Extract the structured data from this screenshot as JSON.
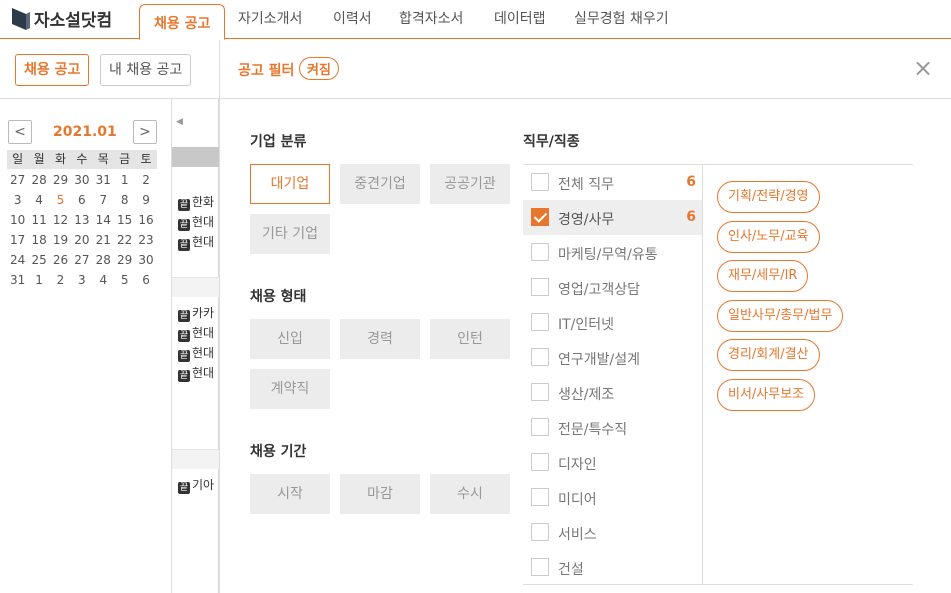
{
  "brand": {
    "name": "자소설닷컴"
  },
  "nav": {
    "tabs": [
      "채용 공고",
      "자기소개서",
      "이력서",
      "합격자소서",
      "데이터랩",
      "실무경험 채우기"
    ]
  },
  "subnav": {
    "buttons": [
      "채용 공고",
      "내 채용 공고"
    ]
  },
  "calendar": {
    "month": "2021.01",
    "prev": "<",
    "next": ">",
    "weekdays": [
      "일",
      "월",
      "화",
      "수",
      "목",
      "금",
      "토"
    ],
    "weeks": [
      [
        "27",
        "28",
        "29",
        "30",
        "31",
        "1",
        "2"
      ],
      [
        "3",
        "4",
        "5",
        "6",
        "7",
        "8",
        "9"
      ],
      [
        "10",
        "11",
        "12",
        "13",
        "14",
        "15",
        "16"
      ],
      [
        "17",
        "18",
        "19",
        "20",
        "21",
        "22",
        "23"
      ],
      [
        "24",
        "25",
        "26",
        "27",
        "28",
        "29",
        "30"
      ],
      [
        "31",
        "1",
        "2",
        "3",
        "4",
        "5",
        "6"
      ]
    ]
  },
  "list": {
    "badge": "끝",
    "groups": [
      [
        "한화",
        "현대",
        "현대"
      ],
      [
        "카카",
        "현대",
        "현대",
        "현대"
      ],
      [
        "기아"
      ]
    ]
  },
  "filter": {
    "title": "공고 필터",
    "badge": "켜짐",
    "close": "×",
    "company": {
      "label": "기업 분류",
      "options": [
        "대기업",
        "중견기업",
        "공공기관",
        "기타 기업"
      ]
    },
    "type": {
      "label": "채용 형태",
      "options": [
        "신입",
        "경력",
        "인턴",
        "계약직"
      ]
    },
    "period": {
      "label": "채용 기간",
      "options": [
        "시작",
        "마감",
        "수시"
      ]
    },
    "jobs": {
      "label": "직무/직종",
      "categories": [
        {
          "name": "전체 직무",
          "count": "6"
        },
        {
          "name": "경영/사무",
          "count": "6"
        },
        {
          "name": "마케팅/무역/유통"
        },
        {
          "name": "영업/고객상담"
        },
        {
          "name": "IT/인터넷"
        },
        {
          "name": "연구개발/설계"
        },
        {
          "name": "생산/제조"
        },
        {
          "name": "전문/특수직"
        },
        {
          "name": "디자인"
        },
        {
          "name": "미디어"
        },
        {
          "name": "서비스"
        },
        {
          "name": "건설"
        }
      ],
      "subcategories": [
        "기획/전략/경영",
        "인사/노무/교육",
        "재무/세무/IR",
        "일반사무/총무/법무",
        "경리/회계/결산",
        "비서/사무보조"
      ]
    }
  },
  "colors": {
    "accent": "#e8772e"
  }
}
